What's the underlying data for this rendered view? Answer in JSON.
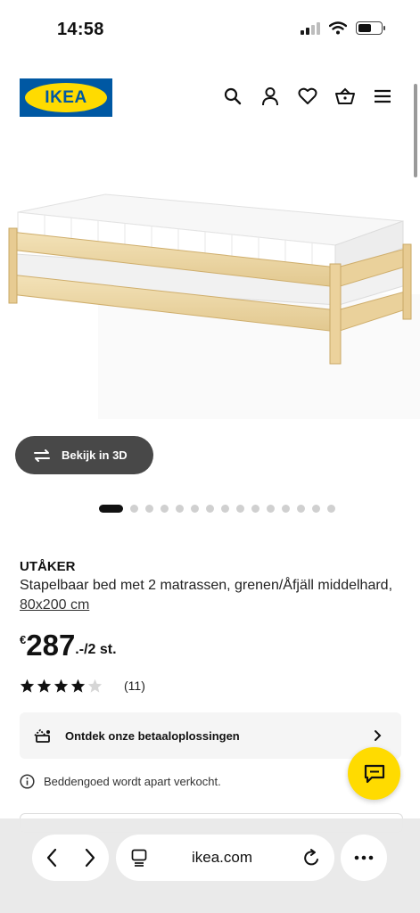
{
  "status_bar": {
    "time": "14:58"
  },
  "header": {
    "logo_text": "IKEA",
    "icons": [
      "search-icon",
      "account-icon",
      "heart-icon",
      "basket-icon",
      "menu-icon"
    ]
  },
  "gallery": {
    "view_3d_label": "Bekijk in 3D",
    "image_count": 15,
    "active_index": 0
  },
  "product": {
    "name": "UTÅKER",
    "description": "Stapelbaar bed met 2 matrassen, grenen/Åfjäll middelhard,",
    "size": "80x200 cm",
    "currency": "€",
    "price": "287",
    "price_suffix": ".-/2 st.",
    "rating": 4,
    "rating_max": 5,
    "review_count": "(11)"
  },
  "payment": {
    "label": "Ontdek onze betaaloplossingen"
  },
  "notice": {
    "text": "Beddengoed wordt apart verkocht."
  },
  "browser": {
    "url": "ikea.com"
  },
  "colors": {
    "ikea_blue": "#0058a3",
    "ikea_yellow": "#ffdb00",
    "button_dark": "#484848"
  }
}
